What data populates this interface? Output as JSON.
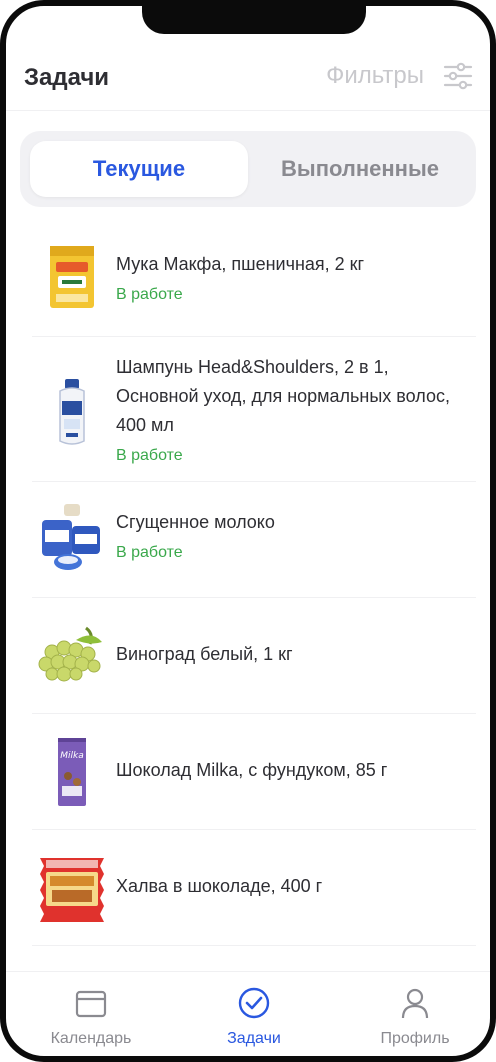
{
  "header": {
    "title": "Задачи",
    "filters_label": "Фильтры"
  },
  "segment": {
    "active": "Текущие",
    "inactive": "Выполненные"
  },
  "items": [
    {
      "name": "Мука Макфа, пшеничная, 2 кг",
      "status": "В работе",
      "icon": "flour-bag"
    },
    {
      "name": "Шампунь Head&Shoulders, 2 в 1, Основной уход, для нормальных волос, 400 мл",
      "status": "В работе",
      "icon": "shampoo-bottle"
    },
    {
      "name": "Сгущенное молоко",
      "status": "В работе",
      "icon": "condensed-milk"
    },
    {
      "name": "Виноград белый, 1 кг",
      "status": "",
      "icon": "grapes"
    },
    {
      "name": "Шоколад Milka, с фундуком, 85 г",
      "status": "",
      "icon": "chocolate-bar"
    },
    {
      "name": "Халва в шоколаде, 400 г",
      "status": "",
      "icon": "halva-pack"
    }
  ],
  "nav": {
    "calendar": "Календарь",
    "tasks": "Задачи",
    "profile": "Профиль"
  },
  "colors": {
    "accent": "#2a58e0",
    "status_green": "#3aa84b",
    "muted": "#8a8a90",
    "text": "#2e2e33"
  }
}
